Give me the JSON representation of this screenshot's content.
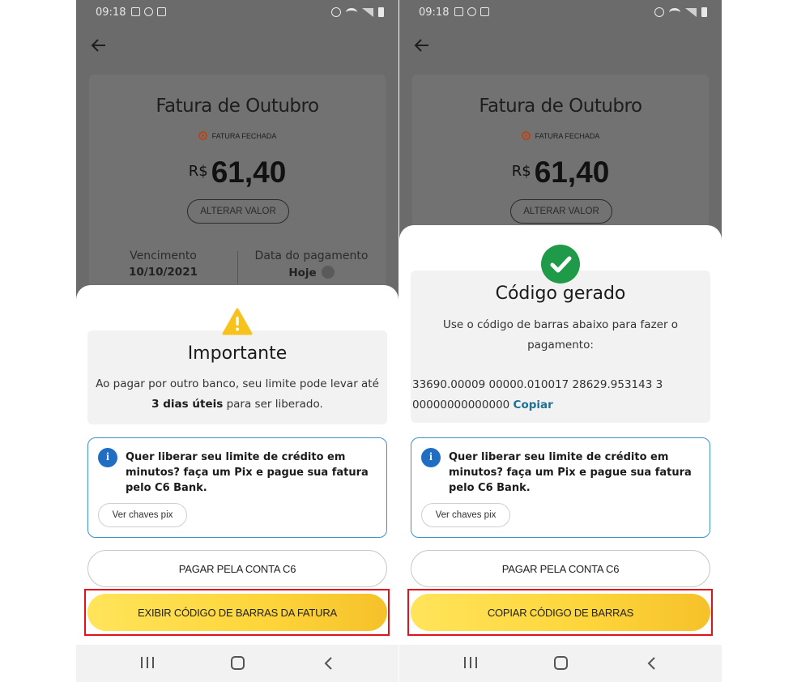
{
  "status_bar": {
    "time": "09:18",
    "lte": "VoLTE\nLTE1"
  },
  "screens": [
    {
      "invoice": {
        "title": "Fatura de Outubro",
        "status": "FATURA FECHADA",
        "currency": "R$",
        "amount": "61,40",
        "alter_button": "ALTERAR VALOR",
        "due_label": "Vencimento",
        "due_value": "10/10/2021",
        "payment_label": "Data do pagamento",
        "payment_value": "Hoje"
      },
      "sheet": {
        "title": "Importante",
        "text_before": "Ao pagar por outro banco, seu limite pode levar até ",
        "text_bold": "3 dias úteis",
        "text_after": " para ser liberado.",
        "pix_text": "Quer liberar seu limite de crédito em minutos? faça um Pix e pague sua fatura pelo C6 Bank.",
        "pix_button": "Ver chaves pix",
        "secondary_button": "PAGAR PELA CONTA C6",
        "primary_button": "EXIBIR CÓDIGO DE BARRAS DA FATURA"
      }
    },
    {
      "invoice": {
        "title": "Fatura de Outubro",
        "status": "FATURA FECHADA",
        "currency": "R$",
        "amount": "61,40",
        "alter_button": "ALTERAR VALOR"
      },
      "sheet": {
        "title": "Código gerado",
        "text": "Use o código de barras abaixo para fazer o pagamento:",
        "barcode": "33690.00009  00000.010017  28629.953143  3 00000000000000",
        "copy_link": "Copiar",
        "pix_text": "Quer liberar seu limite de crédito em minutos? faça um Pix e pague sua fatura pelo C6 Bank.",
        "pix_button": "Ver chaves pix",
        "secondary_button": "PAGAR PELA CONTA C6",
        "primary_button": "COPIAR CÓDIGO DE BARRAS"
      }
    }
  ],
  "colors": {
    "overlay": "#6b6b6b",
    "accent_yellow": "#fdd53a",
    "info_blue": "#1f6ec4",
    "success_green": "#1f9a48",
    "highlight_red": "#e0121b",
    "link_blue": "#1f6e96"
  },
  "icons": [
    "back-arrow-icon",
    "warning-icon",
    "check-icon",
    "info-icon",
    "edit-icon",
    "nav-recent-icon",
    "nav-home-icon",
    "nav-back-icon"
  ]
}
